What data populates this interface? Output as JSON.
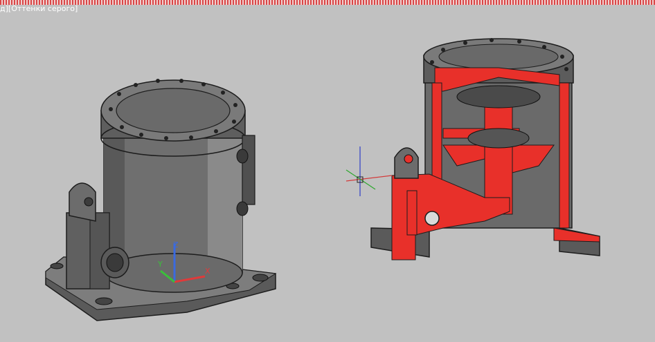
{
  "viewport": {
    "label": "д][Оттенки серого]",
    "visual_style": "Оттенки серого"
  },
  "colors": {
    "background": "#c1c1c1",
    "model_dark": "#3a3a3a",
    "model_mid": "#6b6b6b",
    "model_light": "#9a9a9a",
    "section_fill": "#e8302a",
    "ucs_x": "#e03a3a",
    "ucs_y": "#3ac03a",
    "ucs_z": "#3a6ae0"
  },
  "ucs_icon": {
    "x_label": "X",
    "y_label": "Y",
    "z_label": "Z"
  },
  "icons": [
    "ucs-icon",
    "crosshair-cursor-icon"
  ]
}
